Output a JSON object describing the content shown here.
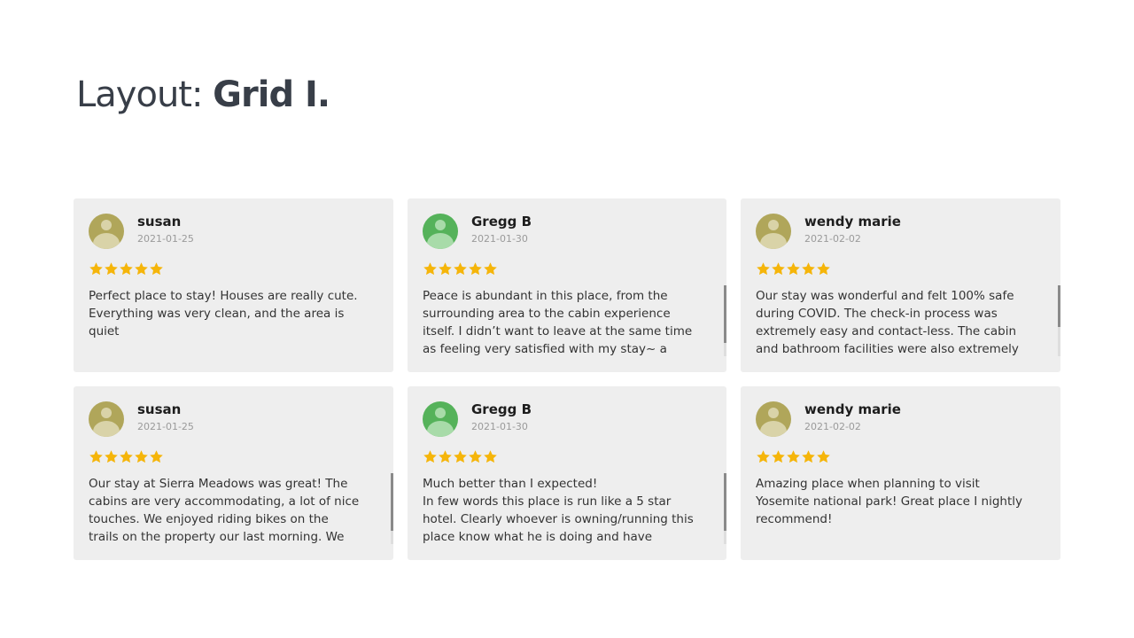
{
  "title": {
    "prefix": "Layout:",
    "emphasis": "Grid I."
  },
  "colors": {
    "star": "#f5b50a",
    "card_bg": "#eeeeee",
    "avatar_olive": "#b0a65a",
    "avatar_green": "#55b25a"
  },
  "reviews": [
    {
      "name": "susan",
      "date": "2021-01-25",
      "rating": 5,
      "avatar_color": "olive",
      "text": "Perfect place to stay! Houses are really cute. Everything was very clean, and the area is quiet",
      "scrollable": false
    },
    {
      "name": "Gregg B",
      "date": "2021-01-30",
      "rating": 5,
      "avatar_color": "green",
      "text": "Peace is abundant in this place, from the surrounding area to the cabin experience itself. I didn’t want to leave at the same time as feeling very satisfied with my stay~ a rare",
      "scrollable": true
    },
    {
      "name": "wendy marie",
      "date": "2021-02-02",
      "rating": 5,
      "avatar_color": "olive",
      "text": "Our stay was wonderful and felt 100% safe during COVID. The check-in process was extremely easy and contact-less. The cabin and bathroom facilities were also extremely clean. I",
      "scrollable": true
    },
    {
      "name": "susan",
      "date": "2021-01-25",
      "rating": 5,
      "avatar_color": "olive",
      "text": "Our stay at Sierra Meadows was great! The cabins are very accommodating, a lot of nice touches. We enjoyed riding bikes on the trails on the property our last morning. We definitely",
      "scrollable": true
    },
    {
      "name": "Gregg B",
      "date": "2021-01-30",
      "rating": 5,
      "avatar_color": "green",
      "text": "Much better than I expected!\nIn few words this place is run like a 5 star hotel. Clearly whoever is owning/running this place know what he is doing and have passion for it!",
      "scrollable": true
    },
    {
      "name": "wendy marie",
      "date": "2021-02-02",
      "rating": 5,
      "avatar_color": "olive",
      "text": "Amazing place when planning to visit Yosemite national park! Great place I nightly recommend!",
      "scrollable": false
    }
  ]
}
